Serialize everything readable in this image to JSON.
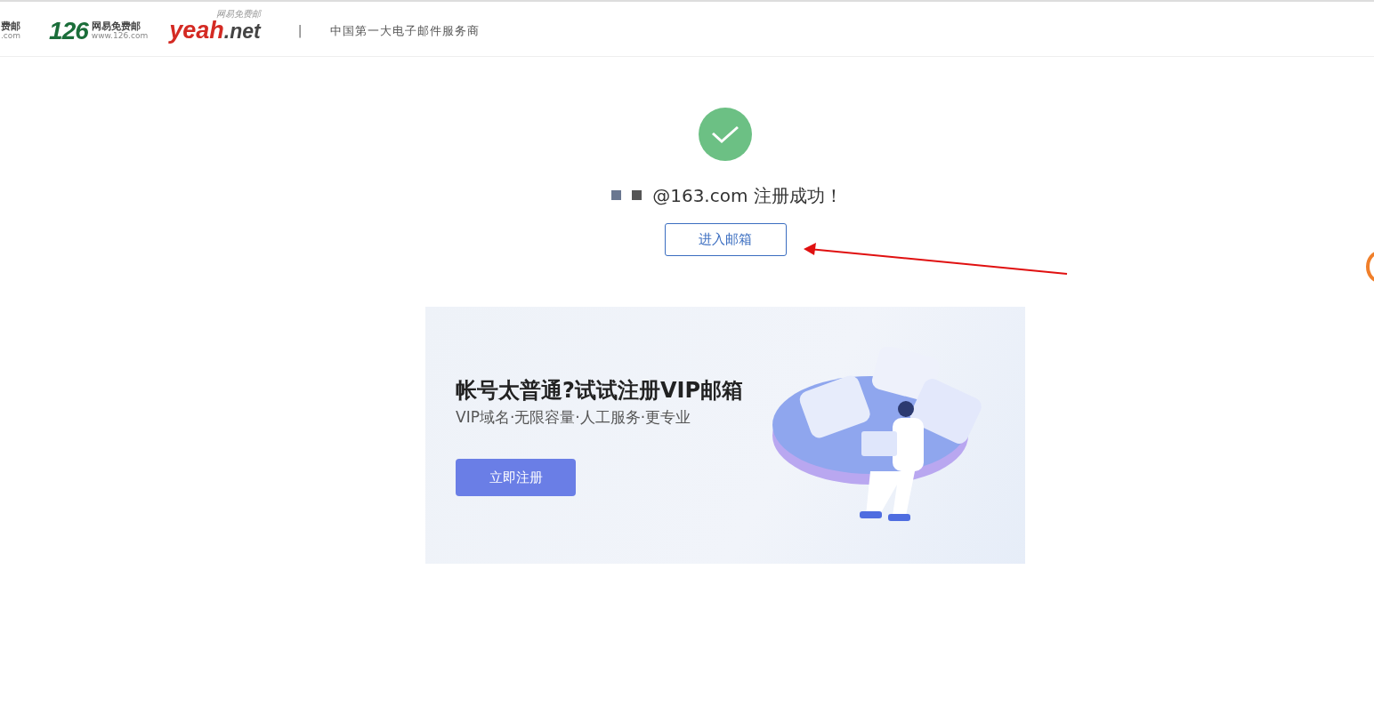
{
  "header": {
    "cut_logo": {
      "name": "费邮",
      "domain": ".com"
    },
    "logo_126": {
      "mark": "126",
      "name": "网易免费邮",
      "domain": "www.126.com"
    },
    "logo_yeah": {
      "word": "yeah",
      "suffix": ".net",
      "tag": "网易免费邮"
    },
    "separator": "|",
    "tagline": "中国第一大电子邮件服务商"
  },
  "result": {
    "message": "@163.com 注册成功！",
    "button": "进入邮箱"
  },
  "banner": {
    "title": "帐号太普通?试试注册VIP邮箱",
    "subtitle": "VIP域名·无限容量·人工服务·更专业",
    "button": "立即注册"
  }
}
